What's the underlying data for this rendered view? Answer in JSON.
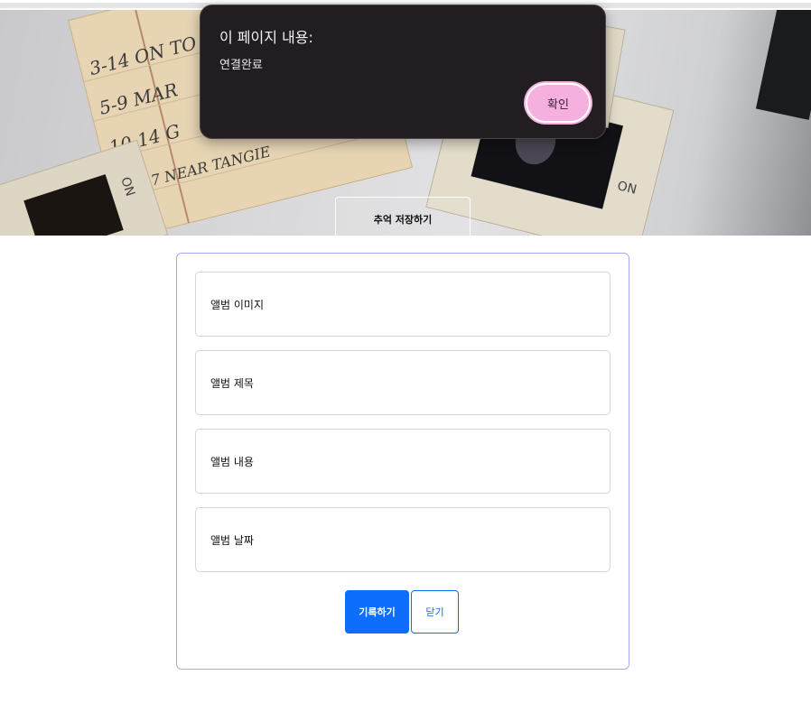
{
  "hero": {
    "image_icon": "vintage-slides-and-notes-photo",
    "handwritten_notes": [
      "3-14 ON TO",
      "5-9 MAR",
      "10-14 G",
      "15-17 NEAR TANGIE"
    ],
    "slide_marks": [
      "ON",
      "ON"
    ],
    "save_memory_label": "추억 저장하기"
  },
  "dialog": {
    "title": "이 페이지 내용:",
    "message": "연결완료",
    "ok_label": "확인"
  },
  "form": {
    "fields": [
      {
        "label": "앨범 이미지"
      },
      {
        "label": "앨범 제목"
      },
      {
        "label": "앨범 내용"
      },
      {
        "label": "앨범 날짜"
      }
    ],
    "record_label": "기록하기",
    "close_label": "닫기"
  },
  "colors": {
    "primary": "#0d6efd",
    "dialog_bg": "#221d20",
    "dialog_button": "#f5b0e0",
    "card_border": "#a9a9ef"
  }
}
